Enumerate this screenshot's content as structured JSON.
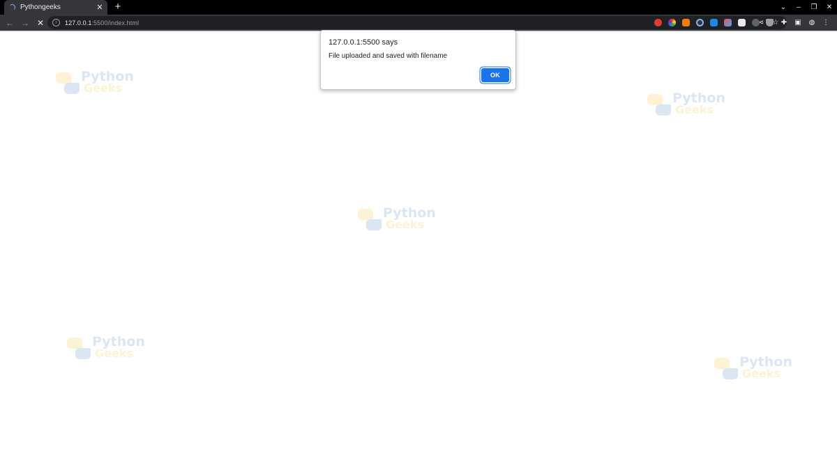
{
  "browser": {
    "tab": {
      "title": "Pythongeeks",
      "close_icon": "close-icon"
    },
    "new_tab_label": "+",
    "window_controls": [
      "chevron-down-icon",
      "minimize-icon",
      "restore-icon",
      "close-icon"
    ],
    "address_bar": {
      "url_host": "127.0.0.1",
      "url_path": ":5500/index.html"
    },
    "extension_colors": [
      "#e53935",
      "#8e24aa",
      "#f57c00",
      "#4285f4",
      "#1e88e5",
      "#e8eaed",
      "#9aa0a6",
      "#5f6368",
      "#e8eaed"
    ]
  },
  "page": {
    "watermark": {
      "line1": "Python",
      "line2": "Geeks"
    }
  },
  "alert": {
    "title": "127.0.0.1:5500 says",
    "message": "File uploaded and saved with filename",
    "ok_label": "OK",
    "accent": "#1a73e8"
  }
}
